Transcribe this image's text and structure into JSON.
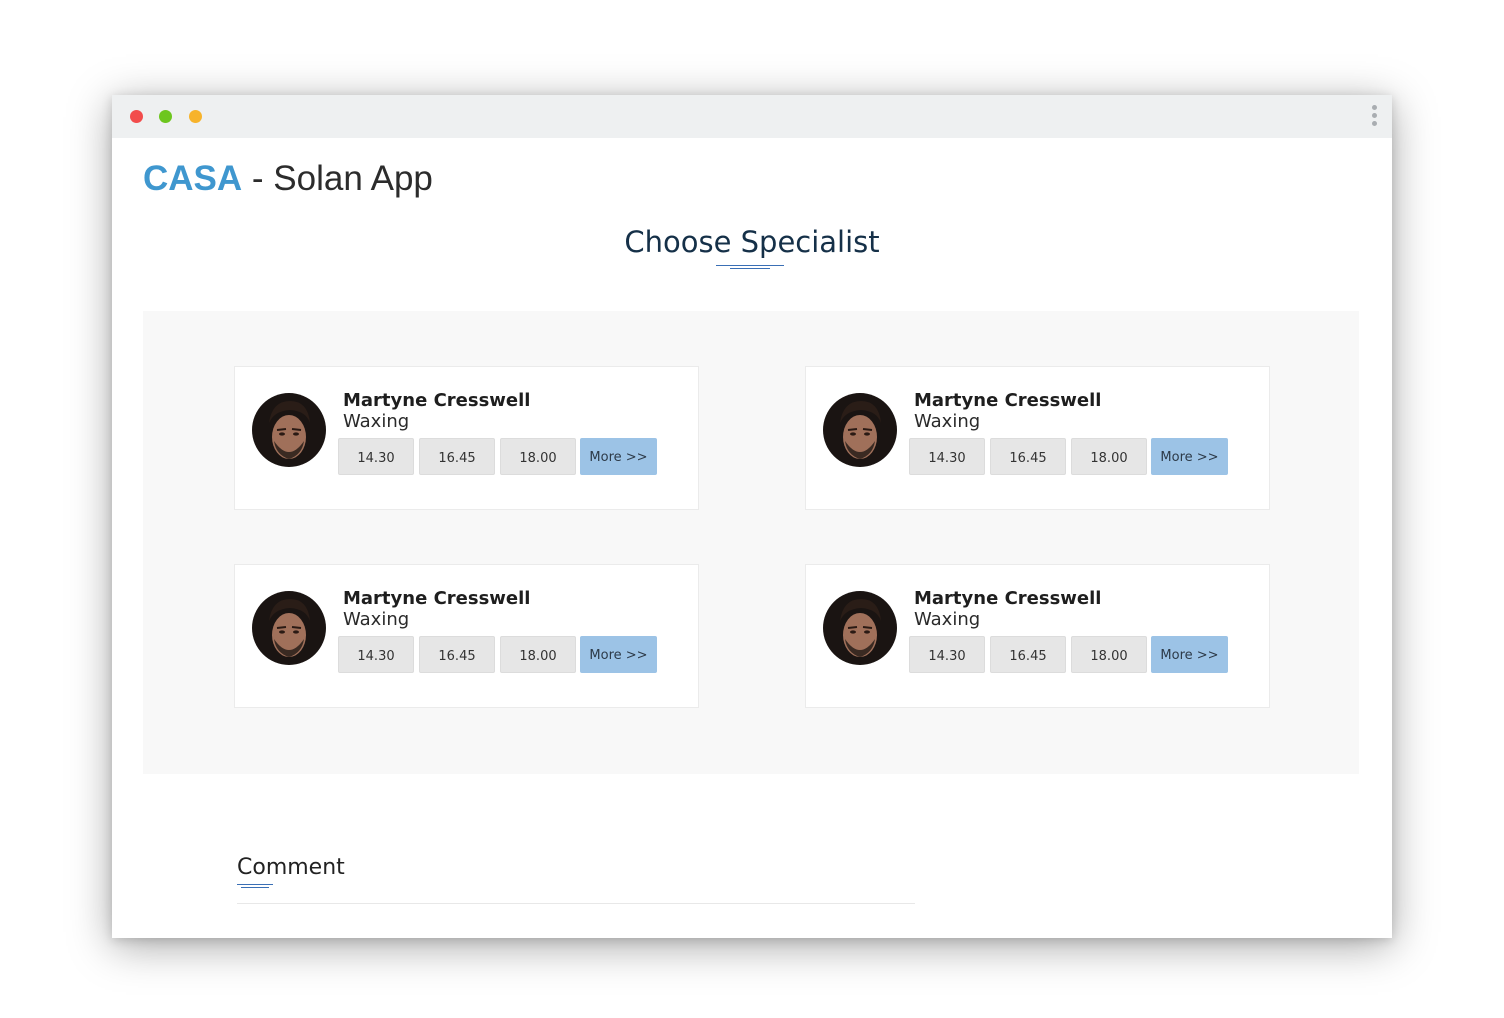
{
  "app": {
    "brand": "CASA",
    "title_rest": " - Solan App"
  },
  "page": {
    "section_title": "Choose Specialist",
    "comment_label": "Comment"
  },
  "specialists": [
    {
      "name": "Martyne Cresswell",
      "service": "Waxing",
      "slots": [
        "14.30",
        "16.45",
        "18.00"
      ],
      "more_label": "More >>"
    },
    {
      "name": "Martyne Cresswell",
      "service": "Waxing",
      "slots": [
        "14.30",
        "16.45",
        "18.00"
      ],
      "more_label": "More >>"
    },
    {
      "name": "Martyne Cresswell",
      "service": "Waxing",
      "slots": [
        "14.30",
        "16.45",
        "18.00"
      ],
      "more_label": "More >>"
    },
    {
      "name": "Martyne Cresswell",
      "service": "Waxing",
      "slots": [
        "14.30",
        "16.45",
        "18.00"
      ],
      "more_label": "More >>"
    }
  ],
  "colors": {
    "brand": "#3f97cf",
    "heading": "#153048",
    "more_button": "#9cc3e6",
    "slot_button": "#e6e6e6",
    "panel_bg": "#f8f8f8"
  },
  "icons": {
    "window_controls": [
      "close-dot",
      "maximize-dot",
      "minimize-dot"
    ],
    "menu": "kebab-menu-icon",
    "avatar": "specialist-avatar"
  }
}
